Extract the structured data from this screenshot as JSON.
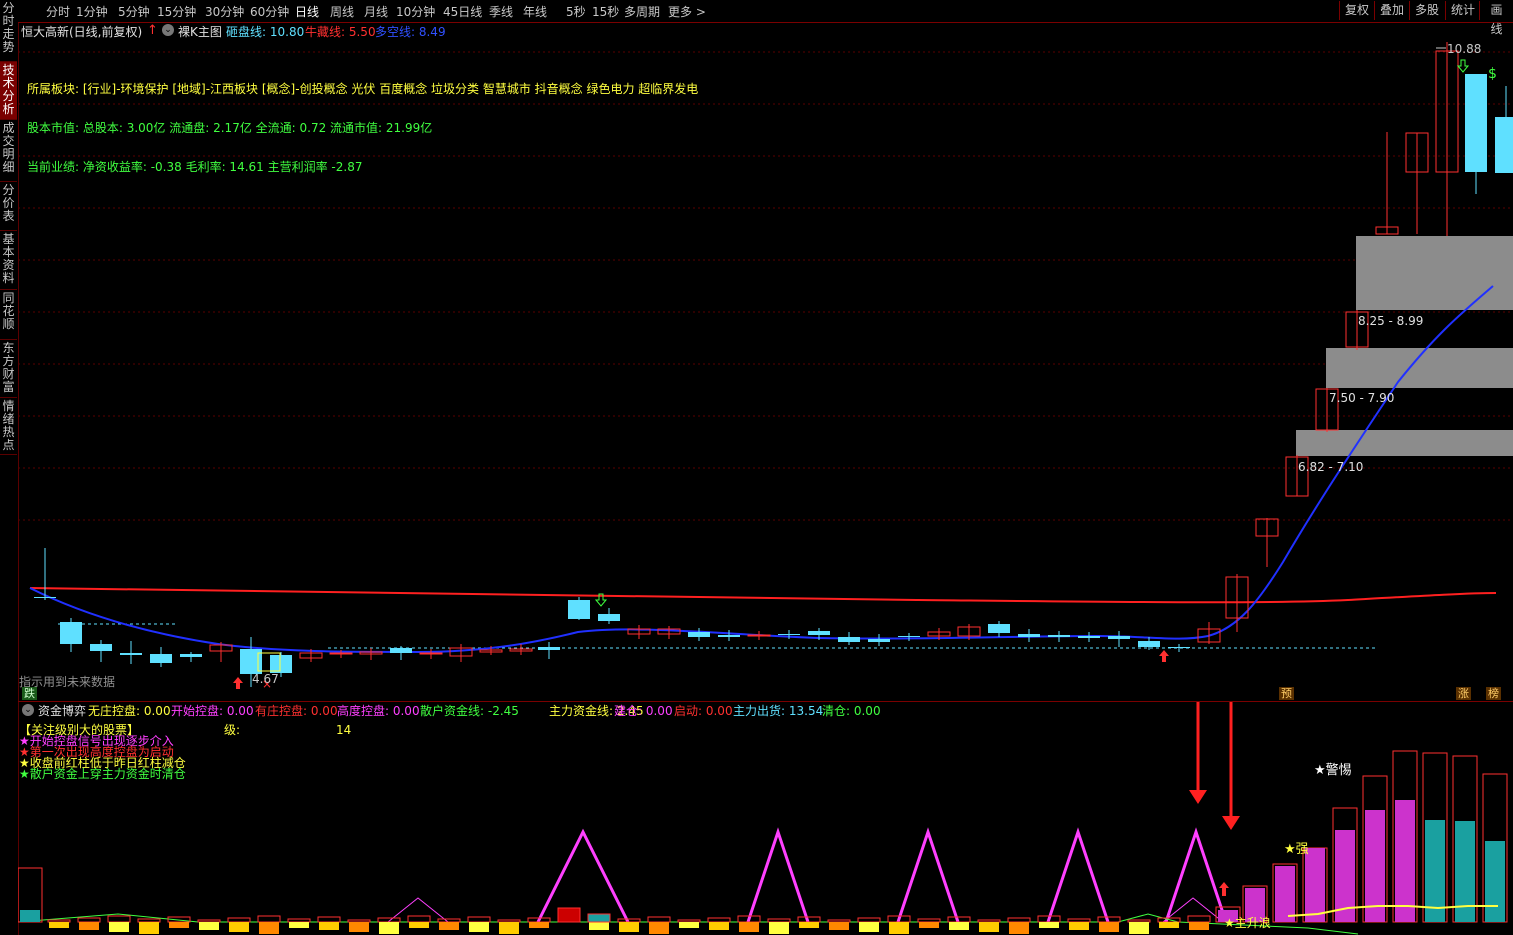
{
  "sidebar": {
    "tabs": [
      {
        "label": "分时走势",
        "active": false
      },
      {
        "label": "技术分析",
        "active": true
      },
      {
        "label": "成交明细",
        "active": false
      },
      {
        "label": "分价表",
        "active": false
      },
      {
        "label": "基本资料",
        "active": false
      },
      {
        "label": "同花顺",
        "active": false
      },
      {
        "label": "东方财富",
        "active": false
      },
      {
        "label": "情绪热点",
        "active": false
      }
    ]
  },
  "toolbar": {
    "timeframes": [
      {
        "label": "分时",
        "active": false
      },
      {
        "label": "1分钟",
        "active": false
      },
      {
        "label": "5分钟",
        "active": false
      },
      {
        "label": "15分钟",
        "active": false
      },
      {
        "label": "30分钟",
        "active": false
      },
      {
        "label": "60分钟",
        "active": false
      },
      {
        "label": "日线",
        "active": true
      },
      {
        "label": "周线",
        "active": false
      },
      {
        "label": "月线",
        "active": false
      },
      {
        "label": "10分钟",
        "active": false
      },
      {
        "label": "45日线",
        "active": false
      },
      {
        "label": "季线",
        "active": false
      },
      {
        "label": "年线",
        "active": false
      },
      {
        "label": "5秒",
        "active": false
      },
      {
        "label": "15秒",
        "active": false
      },
      {
        "label": "多周期",
        "active": false
      },
      {
        "label": "更多 >",
        "active": false
      }
    ],
    "right_buttons": [
      "复权",
      "叠加",
      "多股",
      "统计",
      "画线"
    ]
  },
  "header": {
    "stock_title": "恒大高新(日线,前复权)",
    "indicator_name": "裸K主图",
    "values": [
      {
        "label": "砸盘线: 10.80",
        "color": "#5fe0ff"
      },
      {
        "label": "牛藏线: 5.50",
        "color": "#ff3030"
      },
      {
        "label": "多空线: 8.49",
        "color": "#3050ff"
      }
    ]
  },
  "info": {
    "sector": "所属板块: [行业]-环境保护 [地域]-江西板块 [概念]-创投概念 光伏 百度概念 垃圾分类 智慧城市 抖音概念 绿色电力 超临界发电",
    "market_value": "股本市值: 总股本: 3.00亿 流通盘: 2.17亿 全流通: 0.72 流通市值: 21.99亿",
    "performance": "当前业绩:  净资收益率: -0.38 毛利率: 14.61 主营利润率 -2.87"
  },
  "main_chart": {
    "price_labels": {
      "high": "10.88",
      "low": "4.67",
      "zone1": "8.25 - 8.99",
      "zone2": "7.50 - 7.90",
      "zone3": "6.82 - 7.10"
    },
    "footer_note": "指示用到未来数据",
    "badges": {
      "left": "跌",
      "pre": "预",
      "zhang": "涨",
      "bang": "榜"
    },
    "colors": {
      "up": "#ff3030",
      "down": "#5fe0ff",
      "red_line": "#ff2020",
      "blue_line": "#2030ff",
      "zone": "#8c8c8c"
    }
  },
  "sub_chart": {
    "indicator_name": "资金博弈",
    "values": [
      {
        "label": "无庄控盘: 0.00",
        "color": "#ffff40"
      },
      {
        "label": "开始控盘: 0.00",
        "color": "#ff40ff"
      },
      {
        "label": "有庄控盘: 0.00",
        "color": "#ff3030"
      },
      {
        "label": "高度控盘: 0.00",
        "color": "#ff40ff"
      },
      {
        "label": "散户资金线: -2.45",
        "color": "#40ff40"
      },
      {
        "label": "主力资金线: 2.45",
        "color": "#ffff40"
      },
      {
        "label": "建仓: 0.00",
        "color": "#ff40ff"
      },
      {
        "label": "启动: 0.00",
        "color": "#ff3030"
      },
      {
        "label": "主力出货: 13.54",
        "color": "#5fe0ff"
      },
      {
        "label": "清仓: 0.00",
        "color": "#40ff40"
      }
    ],
    "legend_title": "【关注级别大的股票】",
    "level_label": "级:",
    "level_value": "14",
    "legend_lines": [
      {
        "text": "★开始控盘信号出现逐步介入",
        "color": "#ff40ff"
      },
      {
        "text": "★第一次出现高度控盘为启动",
        "color": "#ff3030"
      },
      {
        "text": "★收盘前红柱低于昨日红柱减仓",
        "color": "#ffff40"
      },
      {
        "text": "★散户资金上穿主力资金时清仓",
        "color": "#40ff40"
      }
    ],
    "annotations": {
      "warning": "★警惕",
      "strong": "★强",
      "rise": "★主升浪"
    }
  }
}
